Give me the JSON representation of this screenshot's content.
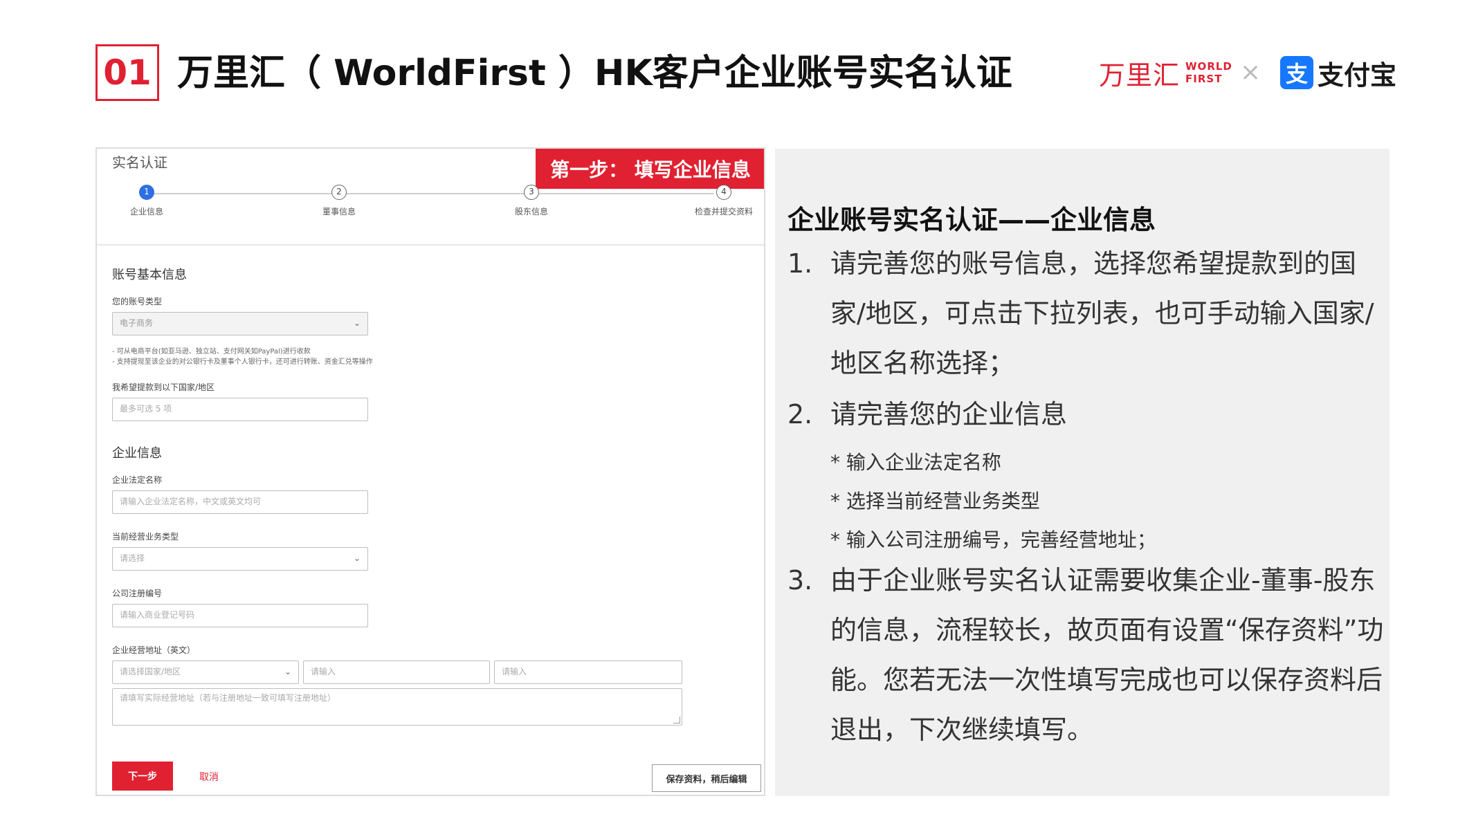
{
  "header": {
    "number": "01",
    "title": "万里汇（ WorldFirst ）HK客户企业账号实名认证",
    "brand_worldfirst_cn": "万里汇",
    "brand_worldfirst_en_1": "WORLD",
    "brand_worldfirst_en_2": "FIRST",
    "brand_separator": "×",
    "brand_alipay_logo_char": "支",
    "brand_alipay": "支付宝"
  },
  "form": {
    "title": "实名认证",
    "step_banner": "第一步：  填写企业信息",
    "steps": [
      {
        "num": "1",
        "label": "企业信息",
        "active": true
      },
      {
        "num": "2",
        "label": "董事信息",
        "active": false
      },
      {
        "num": "3",
        "label": "股东信息",
        "active": false
      },
      {
        "num": "4",
        "label": "检查并提交资料",
        "active": false
      }
    ],
    "section_account": "账号基本信息",
    "account_type_label": "您的账号类型",
    "account_type_value": "电子商务",
    "account_hint_1": "- 可从电商平台(如亚马逊、独立站、支付网关如PayPal)进行收款",
    "account_hint_2": "- 支持提现至该企业的对公银行卡及董事个人银行卡，还可进行转账、资金汇兑等操作",
    "withdraw_region_label": "我希望提款到以下国家/地区",
    "withdraw_region_placeholder": "最多可选 5 项",
    "section_company": "企业信息",
    "legal_name_label": "企业法定名称",
    "legal_name_placeholder": "请输入企业法定名称，中文或英文均可",
    "business_type_label": "当前经营业务类型",
    "business_type_placeholder": "请选择",
    "reg_no_label": "公司注册编号",
    "reg_no_placeholder": "请输入商业登记号码",
    "address_label": "企业经营地址（英文）",
    "address_country_placeholder": "请选择国家/地区",
    "address_field2_placeholder": "请输入",
    "address_field3_placeholder": "请输入",
    "address_detail_placeholder": "请填写实际经营地址（若与注册地址一致可填写注册地址）",
    "next_button": "下一步",
    "cancel_button": "取消",
    "save_button": "保存资料，稍后编辑"
  },
  "explanation": {
    "title": "企业账号实名认证——企业信息",
    "item1_num": "1.",
    "item1_text": "请完善您的账号信息，选择您希望提款到的国家/地区，可点击下拉列表，也可手动输入国家/地区名称选择；",
    "item2_num": "2.",
    "item2_text": "请完善您的企业信息",
    "item2_sub1": "* 输入企业法定名称",
    "item2_sub2": "* 选择当前经营业务类型",
    "item2_sub3": "* 输入公司注册编号，完善经营地址；",
    "item3_num": "3.",
    "item3_text": "由于企业账号实名认证需要收集企业-董事-股东的信息，流程较长，故页面有设置“保存资料”功能。您若无法一次性填写完成也可以保存资料后退出，下次继续填写。"
  },
  "colors": {
    "accent": "#e02132",
    "step_active": "#2f6fe4",
    "alipay_blue": "#1677ff",
    "panel_bg": "#f0f0f0"
  }
}
